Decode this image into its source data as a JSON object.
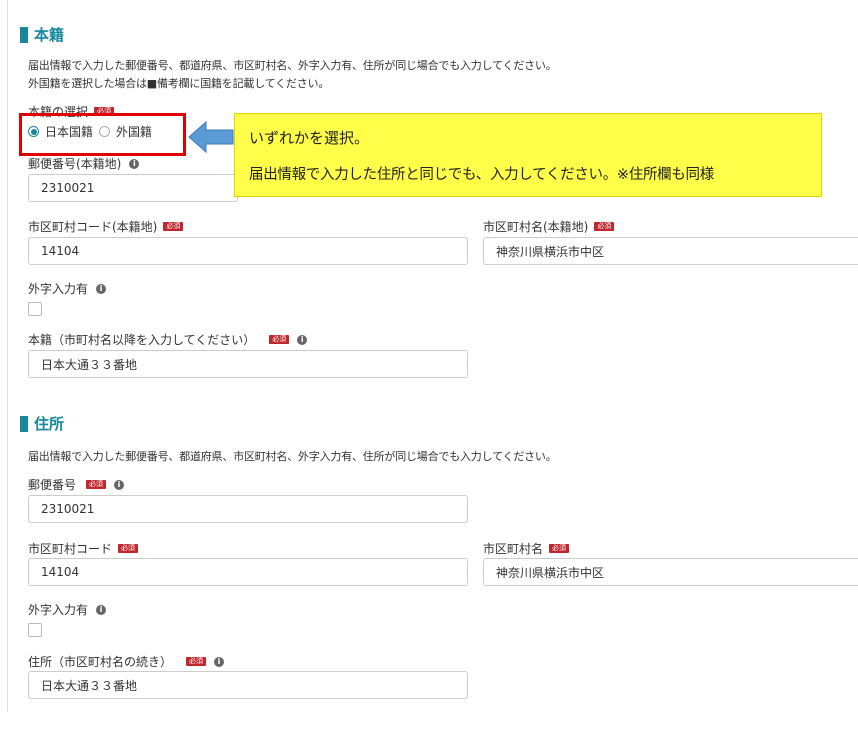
{
  "honseki": {
    "title": "本籍",
    "note1": "届出情報で入力した郵便番号、都道府県、市区町村名、外字入力有、住所が同じ場合でも入力してください。",
    "note2": "外国籍を選択した場合は■備考欄に国籍を記載してください。",
    "selection_label": "本籍の選択",
    "required_badge": "必須",
    "info_icon": "i",
    "radio_options": [
      {
        "label": "日本国籍",
        "checked": true
      },
      {
        "label": "外国籍",
        "checked": false
      }
    ],
    "postal_label": "郵便番号(本籍地)",
    "postal_value": "2310021",
    "city_code_label": "市区町村コード(本籍地)",
    "city_code_value": "14104",
    "city_name_label": "市区町村名(本籍地)",
    "city_name_value": "神奈川県横浜市中区",
    "gaiji_label": "外字入力有",
    "address_label": "本籍（市町村名以降を入力してください）",
    "address_value": "日本大通３３番地"
  },
  "jusho": {
    "title": "住所",
    "note1": "届出情報で入力した郵便番号、都道府県、市区町村名、外字入力有、住所が同じ場合でも入力してください。",
    "postal_label": "郵便番号",
    "postal_value": "2310021",
    "city_code_label": "市区町村コード",
    "city_code_value": "14104",
    "city_name_label": "市区町村名",
    "city_name_value": "神奈川県横浜市中区",
    "gaiji_label": "外字入力有",
    "address_label": "住所（市区町村名の続き）",
    "address_value": "日本大通３３番地"
  },
  "callout": {
    "line1": "いずれかを選択。",
    "line2": "届出情報で入力した住所と同じでも、入力してください。※住所欄も同様"
  },
  "colors": {
    "accent": "#17879c",
    "required": "#c0272d",
    "highlight_border": "#e10000",
    "callout_bg": "#fffe48",
    "arrow": "#5b9bd5"
  }
}
